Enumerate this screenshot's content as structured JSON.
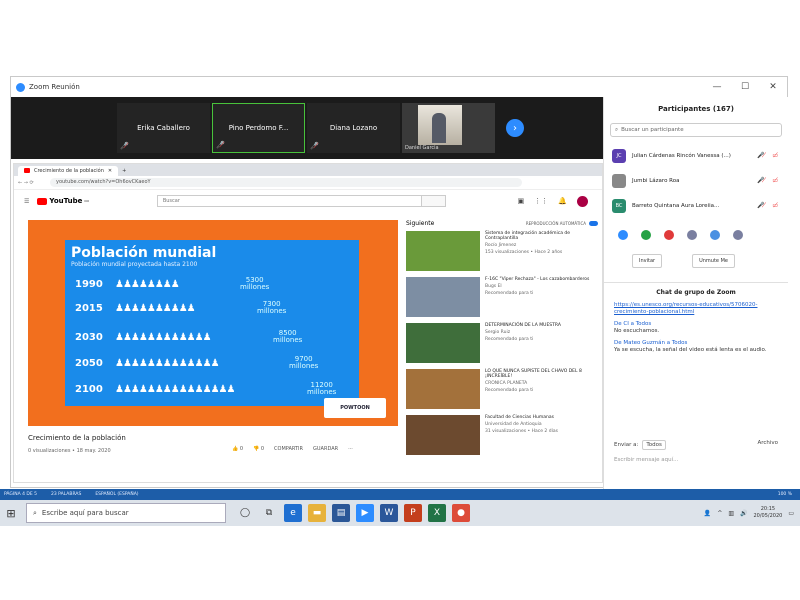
{
  "window": {
    "title": "Zoom Reunión",
    "min": "—",
    "max": "☐",
    "close": "✕"
  },
  "video_strip": {
    "tiles": [
      {
        "name": "Erika Caballero"
      },
      {
        "name": "Pino Perdomo F..."
      },
      {
        "name": "Diana Lozano"
      },
      {
        "name": "Daniel Garcia"
      }
    ]
  },
  "browser": {
    "tab_title": "Crecimiento de la población",
    "url": "youtube.com/watch?v=Oh6ovCKaeoY",
    "search_placeholder": "Buscar",
    "logo_text": "YouTube",
    "logo_country": "CO"
  },
  "slide": {
    "title": "Población mundial",
    "subtitle": "Población mundial proyectada hasta 2100",
    "rows": [
      {
        "year": "1990",
        "people": "♟♟♟♟♟♟♟♟",
        "value": "5300",
        "unit": "millones"
      },
      {
        "year": "2015",
        "people": "♟♟♟♟♟♟♟♟♟♟",
        "value": "7300",
        "unit": "millones"
      },
      {
        "year": "2030",
        "people": "♟♟♟♟♟♟♟♟♟♟♟♟",
        "value": "8500",
        "unit": "millones"
      },
      {
        "year": "2050",
        "people": "♟♟♟♟♟♟♟♟♟♟♟♟♟",
        "value": "9700",
        "unit": "millones"
      },
      {
        "year": "2100",
        "people": "♟♟♟♟♟♟♟♟♟♟♟♟♟♟♟",
        "value": "11200",
        "unit": "millones"
      }
    ],
    "watermark": "POWTOON"
  },
  "video": {
    "title": "Crecimiento de la población",
    "meta": "0 visualizaciones • 18 may. 2020",
    "likes": "0",
    "dislikes": "0",
    "share": "COMPARTIR",
    "save": "GUARDAR",
    "more": "···"
  },
  "recommendations": {
    "header": "Siguiente",
    "autoplay": "REPRODUCCIÓN AUTOMÁTICA",
    "items": [
      {
        "title": "Sistema de integración académica de Contraplantilla",
        "channel": "Rocío Jimenez",
        "meta": "153 visualizaciones • Hace 2 años",
        "color": "#6a9a3a"
      },
      {
        "title": "F-16C \"Viper Rechaza\" - Los cazabombarderos",
        "channel": "Bugs El",
        "meta": "Recomendado para ti",
        "color": "#7d8ea3"
      },
      {
        "title": "DETERMINACIÓN DE LA MUESTRA",
        "channel": "Sergio Ruiz",
        "meta": "Recomendado para ti",
        "color": "#3f6e3b"
      },
      {
        "title": "LO QUE NUNCA SUPISTE DEL CHAVO DEL 8 ¡INCREÍBLE!",
        "channel": "CRONICA PLANETA",
        "meta": "Recomendado para ti",
        "color": "#a3713b"
      },
      {
        "title": "Facultad de Ciencias Humanas",
        "channel": "Universidad de Antioquia",
        "meta": "31 visualizaciones • Hace 2 días",
        "color": "#6c4a2f"
      }
    ]
  },
  "participants_panel": {
    "title": "Participantes (167)",
    "search_placeholder": "Buscar un participante",
    "people": [
      {
        "initials": "JC",
        "name": "Julian Cárdenas Rincón Vanessa (...)",
        "color": "#5b3fb0"
      },
      {
        "initials": "",
        "name": "Jumbi Lázaro Roa",
        "color": "#888888"
      },
      {
        "initials": "BC",
        "name": "Barreto Quintana Aura Loreiia...",
        "color": "#2a8c6e"
      }
    ],
    "invite": "Invitar",
    "unmute": "Unmute Me"
  },
  "chat": {
    "title": "Chat de grupo de Zoom",
    "link": "https://es.unesco.org/recursos-educativos/5706020-crecimiento-poblacional.html",
    "messages": [
      {
        "from": "De CI a Todos",
        "text": "No escuchamos."
      },
      {
        "from": "De Mateo Guzmán a Todos",
        "text": "Ya se escucha, la señal del video está lenta es el audio."
      }
    ],
    "to_label": "Enviar a:",
    "to_value": "Todos",
    "file_label": "Archivo",
    "input_placeholder": "Escribir mensaje aquí..."
  },
  "statusbar": {
    "page": "PÁGINA 4 DE 5",
    "words": "23 PALABRAS",
    "lang": "ESPAÑOL (ESPAÑA)",
    "zoom": "100 %"
  },
  "taskbar": {
    "search_placeholder": "Escribe aquí para buscar",
    "time": "20:15",
    "date": "20/05/2020"
  }
}
